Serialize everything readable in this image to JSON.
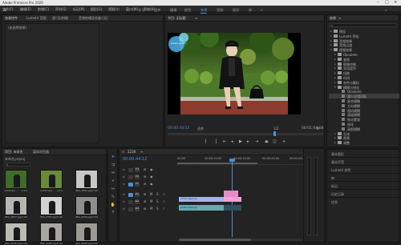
{
  "window": {
    "title": "Adobe Premiere Pro 2020"
  },
  "menubar": {
    "items": [
      "文件(F)",
      "编辑(E)",
      "剪辑(C)",
      "序列(S)",
      "标记(M)",
      "图形(G)",
      "视图(V)",
      "窗口(W)",
      "帮助(H)"
    ]
  },
  "workspaces": {
    "items": [
      "学习",
      "组件",
      "编辑",
      "颜色",
      "效果",
      "音频",
      "图形",
      "库"
    ],
    "active": "效果"
  },
  "source_panel": {
    "tabs": [
      "效果控件",
      "Lumetri 范围",
      "源:(无剪辑)",
      "音频剪辑混合器:(无)"
    ],
    "empty_label": "(未选择剪辑)"
  },
  "program_monitor": {
    "tab": "节目: 无标题",
    "timecode": "00:00:44:12",
    "fit_label": "适合",
    "ratio_label": "1/2",
    "duration": "00:01:04:08",
    "badge_text": "Lorem ipsum",
    "colors": {
      "badge": "#4ab3e8",
      "timecode": "#4a8fd4"
    }
  },
  "project_panel": {
    "tabs": [
      "项目: 未命名",
      "媒体浏览器"
    ],
    "file_name": "未命名.prproj",
    "thumbs": [
      {
        "label": "1234.avi",
        "duration": "2:12"
      },
      {
        "label": "1234.mp4",
        "duration": "1:15"
      },
      {
        "label": "IMG_2091.jpg",
        "duration": "5:00"
      },
      {
        "label": "IMG_2097.jpg",
        "duration": "5:00"
      },
      {
        "label": "IMG_2093.jpg",
        "duration": "5:00"
      },
      {
        "label": "IMG_2094.jpg",
        "duration": "5:00"
      },
      {
        "label": "IMG_2095.jpg",
        "duration": "5:00"
      },
      {
        "label": "IMG_2096.jpg",
        "duration": "5:00"
      },
      {
        "label": "IMG_2098.jpg",
        "duration": "5:00"
      }
    ]
  },
  "timeline": {
    "tab": "1234",
    "timecode": "00:00:44:12",
    "ruler": [
      "00:00",
      "00:00:15:00",
      "00:00:30:00",
      "00:00:45:00",
      "00:01:00:00"
    ],
    "tracks_video": [
      "V3",
      "V2",
      "V1"
    ],
    "tracks_audio": [
      "A1",
      "A2",
      "A3"
    ],
    "clip_v1_label": "1234.mp4 [V]",
    "clip_a1_label": "1234.mp4 [A]",
    "colors": {
      "playhead": "#4a8fd4",
      "video_clip": "#9fb6e6",
      "pink_clip": "#e889c8",
      "audio_clip": "#67a9b0"
    }
  },
  "effects_panel": {
    "header": "效果",
    "tree": [
      {
        "label": "预设",
        "indent": 0,
        "open": false
      },
      {
        "label": "Lumetri 预设",
        "indent": 0,
        "open": false
      },
      {
        "label": "音频效果",
        "indent": 0,
        "open": false
      },
      {
        "label": "音频过渡",
        "indent": 0,
        "open": false
      },
      {
        "label": "视频效果",
        "indent": 0,
        "open": true
      },
      {
        "label": "Obsolete",
        "indent": 1,
        "open": false
      },
      {
        "label": "变换",
        "indent": 1,
        "open": false
      },
      {
        "label": "图像控制",
        "indent": 1,
        "open": false
      },
      {
        "label": "实用程序",
        "indent": 1,
        "open": false
      },
      {
        "label": "扭曲",
        "indent": 1,
        "open": false
      },
      {
        "label": "时间",
        "indent": 1,
        "open": false
      },
      {
        "label": "杂色与颗粒",
        "indent": 1,
        "open": false
      },
      {
        "label": "模糊与锐化",
        "indent": 1,
        "open": true
      },
      {
        "label": "Obsolete",
        "indent": 2,
        "open": false,
        "file": true
      },
      {
        "label": "减少交错闪烁",
        "indent": 2,
        "open": false,
        "file": true,
        "selected": true
      },
      {
        "label": "复合模糊",
        "indent": 2,
        "open": false,
        "file": true
      },
      {
        "label": "方向模糊",
        "indent": 2,
        "open": false,
        "file": true
      },
      {
        "label": "相机模糊",
        "indent": 2,
        "open": false,
        "file": true
      },
      {
        "label": "通道模糊",
        "indent": 2,
        "open": false,
        "file": true
      },
      {
        "label": "钝化蒙版",
        "indent": 2,
        "open": false,
        "file": true
      },
      {
        "label": "锐化",
        "indent": 2,
        "open": false,
        "file": true
      },
      {
        "label": "高斯模糊",
        "indent": 2,
        "open": false,
        "file": true
      },
      {
        "label": "生成",
        "indent": 1,
        "open": false
      },
      {
        "label": "视频",
        "indent": 1,
        "open": false
      },
      {
        "label": "调整",
        "indent": 1,
        "open": false
      }
    ],
    "bottom_sections": [
      "基本图形",
      "基本声音",
      "Lumetri 颜色",
      "库",
      "标记",
      "历史记录",
      "信息"
    ]
  }
}
